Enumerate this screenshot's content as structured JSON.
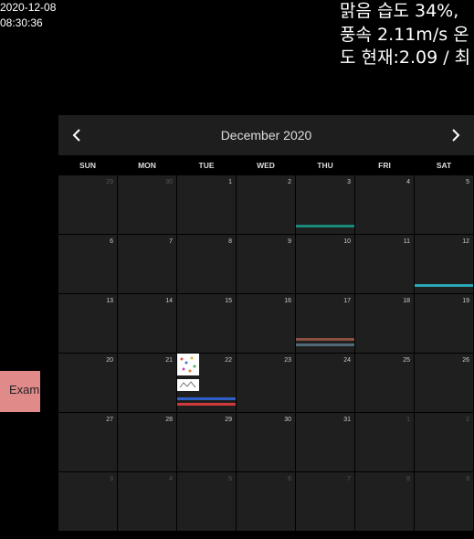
{
  "clock": {
    "date": "2020-12-08",
    "time": "08:30:36"
  },
  "weather": {
    "text": "맑음 습도 34%, 풍속 2.11m/s 온도 현재:2.09 / 최"
  },
  "exam_widget": {
    "label": "Exam"
  },
  "calendar": {
    "title": "December 2020",
    "prev_icon": "chevron-left-icon",
    "next_icon": "chevron-right-icon",
    "weekdays": [
      "SUN",
      "MON",
      "TUE",
      "WED",
      "THU",
      "FRI",
      "SAT"
    ],
    "weeks": [
      [
        {
          "d": "29",
          "other": true
        },
        {
          "d": "30",
          "other": true
        },
        {
          "d": "1"
        },
        {
          "d": "2"
        },
        {
          "d": "3",
          "bars": [
            {
              "color": "#1a8a7a",
              "pos": "low"
            }
          ]
        },
        {
          "d": "4"
        },
        {
          "d": "5"
        }
      ],
      [
        {
          "d": "6"
        },
        {
          "d": "7"
        },
        {
          "d": "8"
        },
        {
          "d": "9"
        },
        {
          "d": "10"
        },
        {
          "d": "11"
        },
        {
          "d": "12",
          "bars": [
            {
              "color": "#2aa6b8",
              "pos": "low"
            }
          ]
        }
      ],
      [
        {
          "d": "13"
        },
        {
          "d": "14"
        },
        {
          "d": "15"
        },
        {
          "d": "16"
        },
        {
          "d": "17",
          "bars": [
            {
              "color": "#8a5040",
              "pos": "mid"
            },
            {
              "color": "#506a78",
              "pos": "low"
            }
          ]
        },
        {
          "d": "18"
        },
        {
          "d": "19"
        }
      ],
      [
        {
          "d": "20"
        },
        {
          "d": "21"
        },
        {
          "d": "22",
          "thumbs": true,
          "bars": [
            {
              "color": "#2f5fc8",
              "pos": "mid"
            },
            {
              "color": "#d03a3a",
              "pos": "low"
            }
          ]
        },
        {
          "d": "23"
        },
        {
          "d": "24"
        },
        {
          "d": "25"
        },
        {
          "d": "26"
        }
      ],
      [
        {
          "d": "27"
        },
        {
          "d": "28"
        },
        {
          "d": "29"
        },
        {
          "d": "30"
        },
        {
          "d": "31"
        },
        {
          "d": "1",
          "other": true
        },
        {
          "d": "2",
          "other": true
        }
      ],
      [
        {
          "d": "3",
          "other": true
        },
        {
          "d": "4",
          "other": true
        },
        {
          "d": "5",
          "other": true
        },
        {
          "d": "6",
          "other": true
        },
        {
          "d": "7",
          "other": true
        },
        {
          "d": "8",
          "other": true
        },
        {
          "d": "9",
          "other": true
        }
      ]
    ]
  },
  "colors": {
    "background": "#000000",
    "cell": "#1f1f1f",
    "header": "#1e1e1e",
    "exam": "#e08a8a"
  }
}
